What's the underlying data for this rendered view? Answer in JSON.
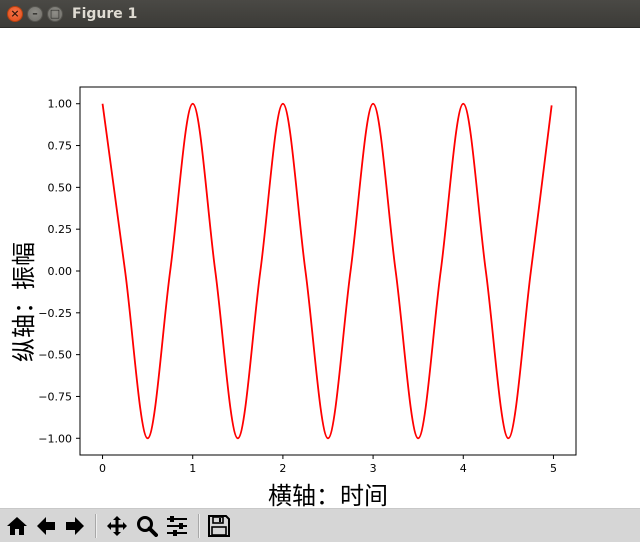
{
  "window": {
    "title": "Figure 1",
    "close_glyph": "×",
    "minimize_glyph": "–",
    "maximize_glyph": "□"
  },
  "toolbar": {
    "buttons": [
      {
        "name": "home-button",
        "icon": "home-icon"
      },
      {
        "name": "back-button",
        "icon": "arrow-left-icon"
      },
      {
        "name": "forward-button",
        "icon": "arrow-right-icon"
      },
      {
        "name": "pan-button",
        "icon": "move-icon"
      },
      {
        "name": "zoom-button",
        "icon": "magnifier-icon"
      },
      {
        "name": "configure-subplots-button",
        "icon": "sliders-icon"
      },
      {
        "name": "save-button",
        "icon": "floppy-disk-icon"
      }
    ]
  },
  "chart_data": {
    "type": "line",
    "title": "",
    "xlabel": "横轴：时间",
    "ylabel": "纵轴：振幅",
    "xlim": [
      -0.25,
      5.25
    ],
    "ylim": [
      -1.1,
      1.1
    ],
    "x_ticks": [
      0,
      1,
      2,
      3,
      4,
      5
    ],
    "x_tick_labels": [
      "0",
      "1",
      "2",
      "3",
      "4",
      "5"
    ],
    "y_ticks": [
      1.0,
      0.75,
      0.5,
      0.25,
      0.0,
      -0.25,
      -0.5,
      -0.75,
      -1.0
    ],
    "y_tick_labels": [
      "1.00",
      "0.75",
      "0.50",
      "0.25",
      "0.00",
      "−0.25",
      "−0.50",
      "−0.75",
      "−1.00"
    ],
    "grid": false,
    "series": [
      {
        "color": "#ff0000",
        "x": [
          0,
          0.25,
          0.5,
          0.75,
          1,
          1.25,
          1.5,
          1.75,
          2,
          2.25,
          2.5,
          2.75,
          3,
          3.25,
          3.5,
          3.75,
          4,
          4.25,
          4.5,
          4.75,
          4.98
        ],
        "y": [
          1,
          0,
          -1,
          0,
          1,
          0,
          -1,
          0,
          1,
          0,
          -1,
          0,
          1,
          0,
          -1,
          0,
          1,
          0,
          -1,
          0,
          0.99
        ]
      }
    ]
  }
}
